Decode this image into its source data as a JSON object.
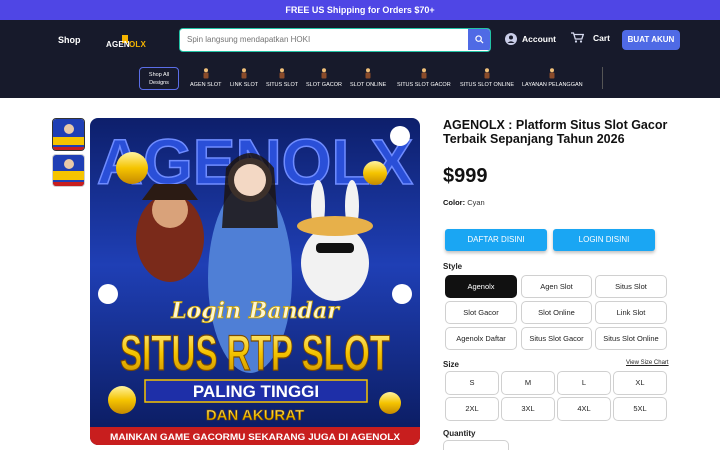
{
  "promo": {
    "free": "FREE",
    "text": " US Shipping for Orders ",
    "amount": "$70+"
  },
  "header": {
    "shop": "Shop",
    "logo": "AGENOLX",
    "search_placeholder": "Spin langsung mendapatkan HOKI",
    "account": "Account",
    "cart": "Cart",
    "cta": "BUAT AKUN"
  },
  "nav": {
    "all_designs": [
      "Shop All",
      "Designs"
    ],
    "categories": [
      "AGEN SLOT",
      "LINK SLOT",
      "SITUS SLOT",
      "SLOT GACOR",
      "SLOT ONLINE",
      "SITUS SLOT GACOR",
      "SITUS SLOT ONLINE",
      "LAYANAN PELANGGAN"
    ]
  },
  "product": {
    "title": "AGENOLX : Platform Situs Slot Gacor Terbaik Sepanjang Tahun 2026",
    "price": "$999",
    "color_label": "Color:",
    "color_value": "Cyan",
    "buttons": {
      "daftar": "DAFTAR DISINI",
      "login": "LOGIN DISINI"
    },
    "style_label": "Style",
    "styles": [
      "Agenolx",
      "Agen Slot",
      "Situs Slot",
      "Slot Gacor",
      "Slot Online",
      "Link Slot",
      "Agenolx Daftar",
      "Situs Slot Gacor",
      "Situs Slot Online"
    ],
    "selected_style": "Agenolx",
    "size_label": "Size",
    "size_chart": "View Size Chart",
    "sizes": [
      "S",
      "M",
      "L",
      "XL",
      "2XL",
      "3XL",
      "4XL",
      "5XL"
    ],
    "quantity_label": "Quantity"
  },
  "banner": {
    "top_text": "AGENOLX",
    "script_text": "Login Bandar",
    "headline": "SITUS RTP SLOT",
    "ribbon": "PALING TINGGI",
    "sub": "DAN AKURAT",
    "footer": "MAINKAN GAME GACORMU SEKARANG JUGA DI AGENOLX"
  },
  "colors": {
    "accent": "#4f6ae5",
    "promo": "#4f46e5",
    "header": "#171a2b",
    "cyan": "#1aa6f3"
  }
}
